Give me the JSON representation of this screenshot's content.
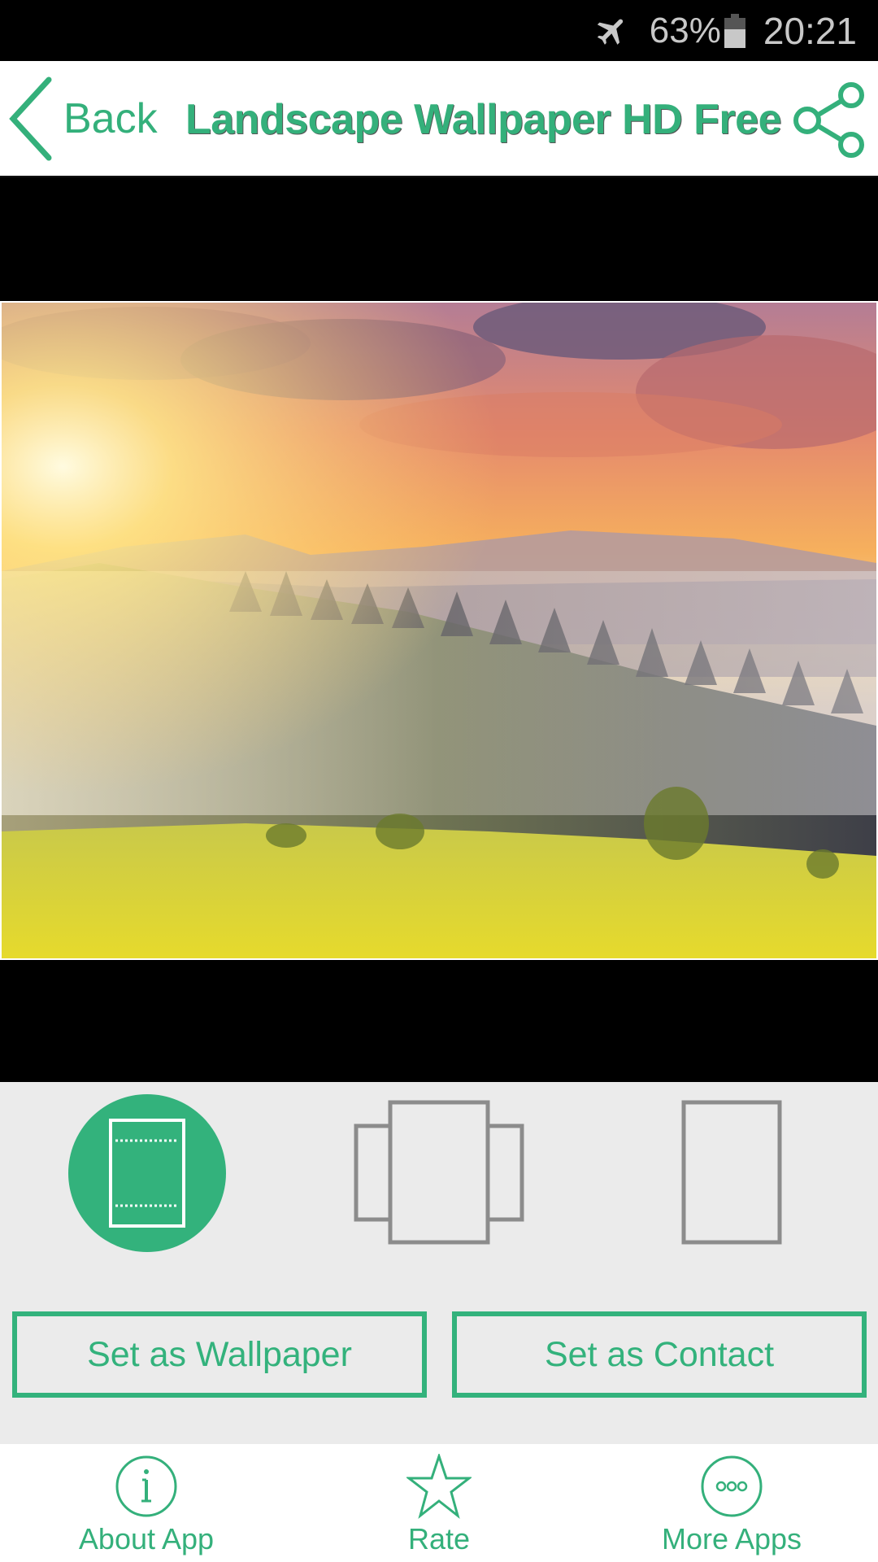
{
  "status_bar": {
    "airplane_icon": "airplane-mode-icon",
    "battery_percent": "63%",
    "battery_level": 0.63,
    "battery_icon": "battery-icon",
    "time": "20:21"
  },
  "header": {
    "back_label": "Back",
    "back_icon": "chevron-left-icon",
    "title": "Landscape Wallpaper HD Free",
    "share_icon": "share-icon"
  },
  "preview": {
    "description": "Sunrise over misty forested mountains with yellow meadow in foreground"
  },
  "modes": [
    {
      "name": "fit",
      "icon": "fit-screen-icon",
      "selected": true
    },
    {
      "name": "scrollable",
      "icon": "scrollable-screens-icon",
      "selected": false
    },
    {
      "name": "fixed",
      "icon": "fixed-screen-icon",
      "selected": false
    }
  ],
  "actions": {
    "set_wallpaper": "Set as Wallpaper",
    "set_contact": "Set as Contact"
  },
  "bottom_nav": {
    "items": [
      {
        "label": "About App",
        "icon": "info-icon"
      },
      {
        "label": "Rate",
        "icon": "star-icon"
      },
      {
        "label": "More Apps",
        "icon": "more-apps-icon"
      }
    ]
  },
  "colors": {
    "accent": "#34b07b",
    "panel_bg": "#ebebeb",
    "icon_gray": "#8c8c8c"
  }
}
